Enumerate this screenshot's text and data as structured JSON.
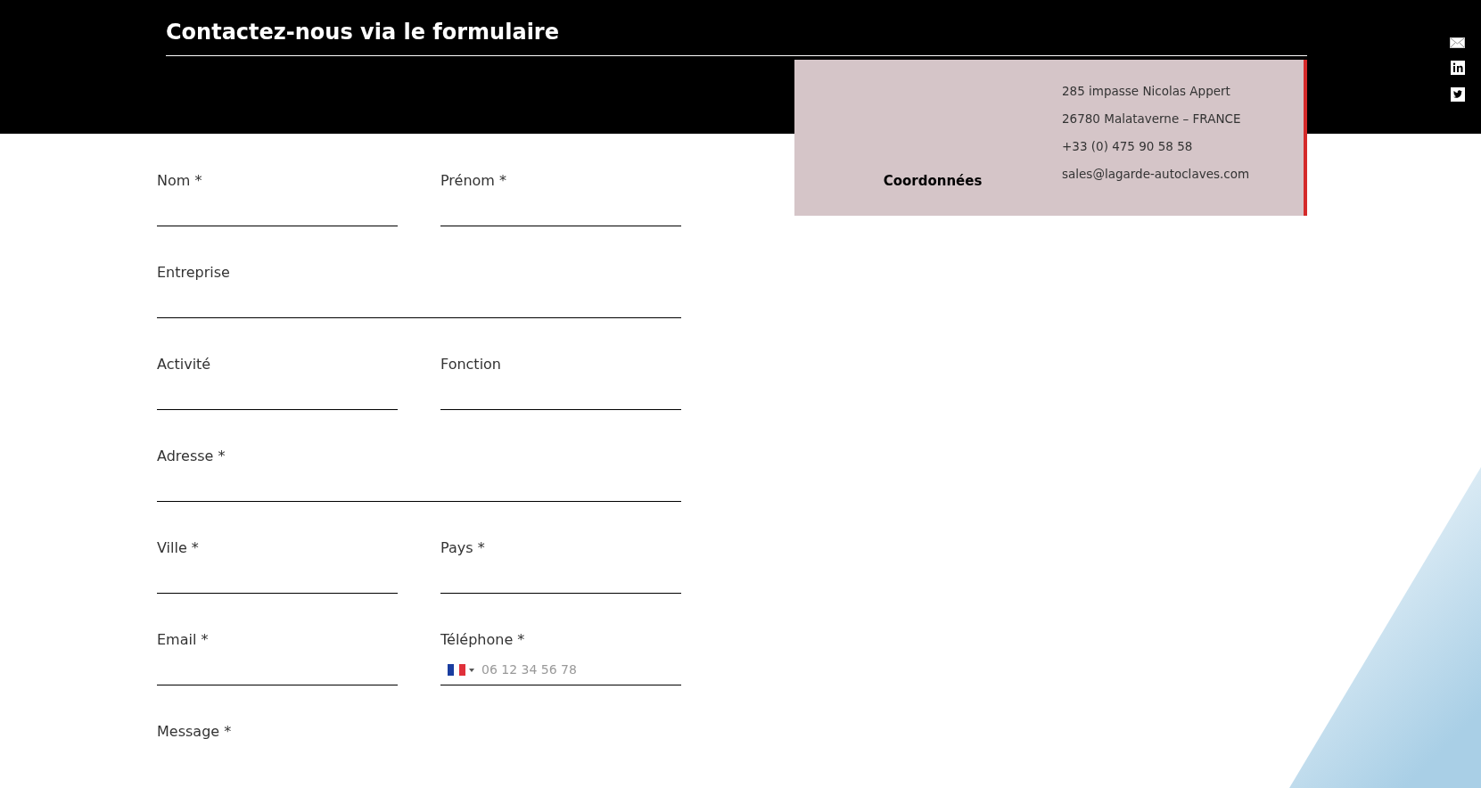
{
  "header": {
    "title": "Contactez-nous via le formulaire"
  },
  "contact_card": {
    "heading": "Coordonnées",
    "lines": [
      "285 impasse Nicolas Appert",
      "26780 Malataverne – FRANCE",
      "+33 (0) 475 90 58 58",
      "sales@lagarde-autoclaves.com"
    ]
  },
  "social_icons": [
    {
      "kind": "email"
    },
    {
      "kind": "linkedin"
    },
    {
      "kind": "twitter"
    }
  ],
  "form": {
    "rows": [
      [
        {
          "label": "Nom *",
          "kind": "text"
        },
        {
          "label": "Prénom *",
          "kind": "text"
        }
      ],
      [
        {
          "label": "Entreprise",
          "kind": "text"
        }
      ],
      [
        {
          "label": "Activité",
          "kind": "text"
        },
        {
          "label": "Fonction",
          "kind": "text"
        }
      ],
      [
        {
          "label": "Adresse *",
          "kind": "text"
        }
      ],
      [
        {
          "label": "Ville *",
          "kind": "text"
        },
        {
          "label": "Pays *",
          "kind": "text"
        }
      ],
      [
        {
          "label": "Email *",
          "kind": "text"
        },
        {
          "label": "Téléphone *",
          "kind": "phone",
          "placeholder": "06 12 34 56 78"
        }
      ],
      [
        {
          "label": "Message *",
          "kind": "textarea"
        }
      ]
    ]
  }
}
